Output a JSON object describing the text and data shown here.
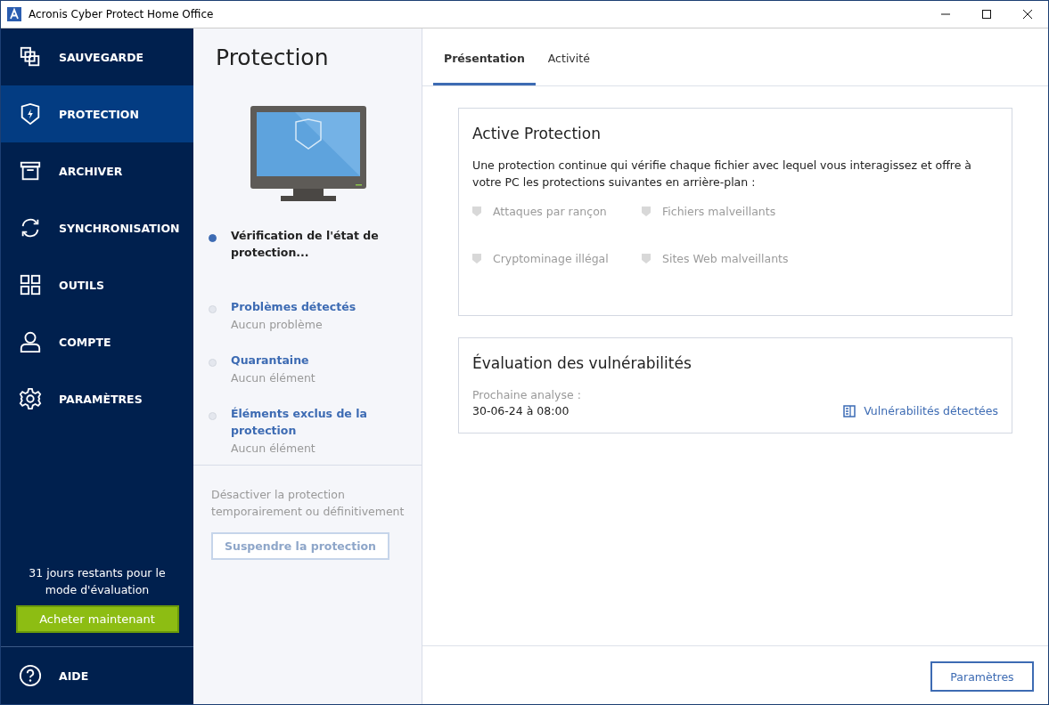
{
  "window": {
    "title": "Acronis Cyber Protect Home Office"
  },
  "sidebar": {
    "items": [
      {
        "label": "SAUVEGARDE",
        "selected": false
      },
      {
        "label": "PROTECTION",
        "selected": true
      },
      {
        "label": "ARCHIVER",
        "selected": false
      },
      {
        "label": "SYNCHRONISATION",
        "selected": false
      },
      {
        "label": "OUTILS",
        "selected": false
      },
      {
        "label": "COMPTE",
        "selected": false
      },
      {
        "label": "PARAMÈTRES",
        "selected": false
      }
    ],
    "trial_text": "31 jours restants pour le mode d'évaluation",
    "buy_button": "Acheter maintenant",
    "help": "AIDE"
  },
  "middle": {
    "title": "Protection",
    "status_items": [
      {
        "title": "Vérification de l'état de protection...",
        "active": true
      },
      {
        "title": "Problèmes détectés",
        "subtitle": "Aucun problème",
        "active": false
      },
      {
        "title": "Quarantaine",
        "subtitle": "Aucun élément",
        "active": false
      },
      {
        "title": "Éléments exclus de la protection",
        "subtitle": "Aucun élément",
        "active": false
      }
    ],
    "disable_text": "Désactiver la protection temporairement ou définitivement",
    "suspend_button": {
      "label": "Suspendre la protection",
      "disabled": true
    }
  },
  "tabs": [
    {
      "label": "Présentation",
      "selected": true
    },
    {
      "label": "Activité",
      "selected": false
    }
  ],
  "active_protection": {
    "title": "Active Protection",
    "description": "Une protection continue qui vérifie chaque fichier avec lequel vous interagissez et offre à votre PC les protections suivantes en arrière-plan :",
    "features": [
      {
        "label": "Attaques par rançon",
        "active": false
      },
      {
        "label": "Fichiers malveillants",
        "active": false
      },
      {
        "label": "Cryptominage illégal",
        "active": false
      },
      {
        "label": "Sites Web malveillants",
        "active": false
      }
    ]
  },
  "vulnerability": {
    "title": "Évaluation des vulnérabilités",
    "next_label": "Prochaine analyse :",
    "next_value": "30-06-24 à 08:00",
    "link": "Vulnérabilités détectées"
  },
  "footer_button": "Paramètres"
}
